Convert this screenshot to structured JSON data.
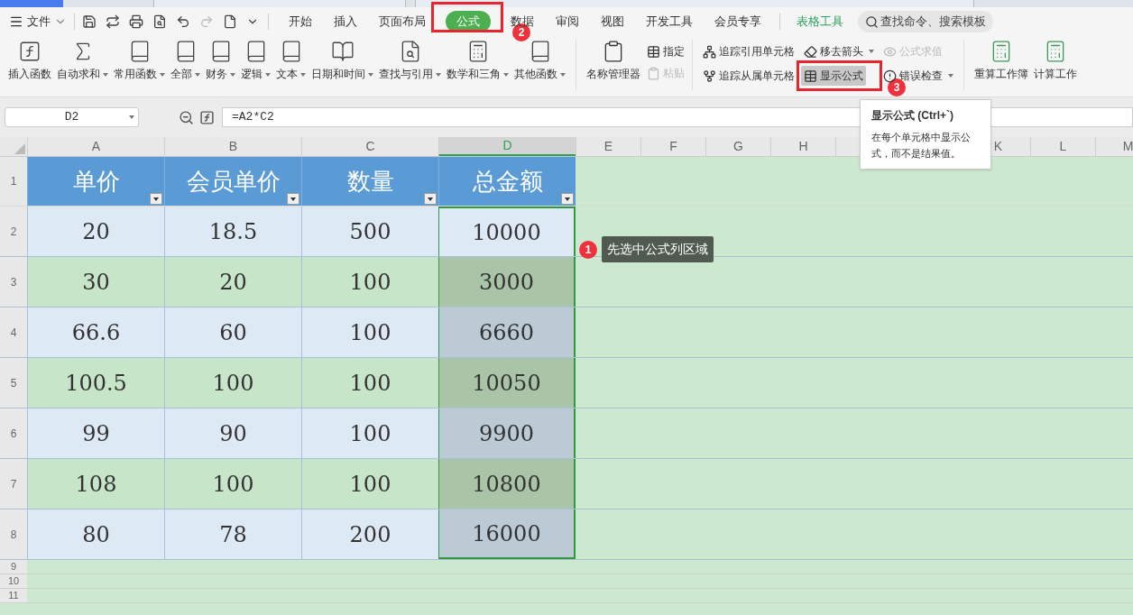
{
  "menu_bar": {
    "file_menu": "文件",
    "tabs": [
      {
        "label": "开始",
        "selected": false
      },
      {
        "label": "插入",
        "selected": false
      },
      {
        "label": "页面布局",
        "selected": false
      },
      {
        "label": "公式",
        "selected": true
      },
      {
        "label": "数据",
        "selected": false
      },
      {
        "label": "审阅",
        "selected": false
      },
      {
        "label": "视图",
        "selected": false
      },
      {
        "label": "开发工具",
        "selected": false
      },
      {
        "label": "会员专享",
        "selected": false
      }
    ],
    "context_tab": "表格工具",
    "search": {
      "placeholder": "查找命令、搜索模板"
    }
  },
  "ribbon": {
    "function_buttons": [
      {
        "label": "插入函数",
        "dropdown": false
      },
      {
        "label": "自动求和",
        "dropdown": true
      },
      {
        "label": "常用函数",
        "dropdown": true
      },
      {
        "label": "全部",
        "dropdown": true
      },
      {
        "label": "财务",
        "dropdown": true
      },
      {
        "label": "逻辑",
        "dropdown": true
      },
      {
        "label": "文本",
        "dropdown": true
      },
      {
        "label": "日期和时间",
        "dropdown": true
      },
      {
        "label": "查找与引用",
        "dropdown": true
      },
      {
        "label": "数学和三角",
        "dropdown": true
      },
      {
        "label": "其他函数",
        "dropdown": true
      }
    ],
    "name_manager": "名称管理器",
    "name_buttons": [
      {
        "label": "指定",
        "disabled": false
      },
      {
        "label": "粘贴",
        "disabled": true
      }
    ],
    "audit_buttons": [
      {
        "label": "追踪引用单元格",
        "dropdown": false,
        "disabled": false,
        "selected": false
      },
      {
        "label": "追踪从属单元格",
        "dropdown": false,
        "disabled": false,
        "selected": false
      },
      {
        "label": "移去箭头",
        "dropdown": true,
        "disabled": false,
        "selected": false
      },
      {
        "label": "显示公式",
        "dropdown": false,
        "disabled": false,
        "selected": true
      },
      {
        "label": "公式求值",
        "dropdown": false,
        "disabled": true,
        "selected": false
      },
      {
        "label": "错误检查",
        "dropdown": true,
        "disabled": false,
        "selected": false
      }
    ],
    "calc_buttons": [
      "重算工作簿",
      "计算工作"
    ]
  },
  "formula_bar": {
    "cell_ref": "D2",
    "formula": "=A2*C2"
  },
  "tooltip": {
    "title": "显示公式 (Ctrl+`)",
    "body": "在每个单元格中显示公式，而不是结果值。"
  },
  "sheet": {
    "columns": [
      {
        "label": "A",
        "selected": false
      },
      {
        "label": "B",
        "selected": false
      },
      {
        "label": "C",
        "selected": false
      },
      {
        "label": "D",
        "selected": true
      }
    ],
    "columns_right": [
      "E",
      "F",
      "G",
      "H"
    ],
    "columns_far": [
      "K",
      "L",
      "M"
    ],
    "table_headers": [
      "单价",
      "会员单价",
      "数量",
      "总金额"
    ],
    "rows": [
      {
        "number": "2",
        "active": true,
        "cells": [
          "20",
          "18.5",
          "500",
          "10000"
        ]
      },
      {
        "number": "3",
        "active": false,
        "cells": [
          "30",
          "20",
          "100",
          "3000"
        ]
      },
      {
        "number": "4",
        "active": false,
        "cells": [
          "66.6",
          "60",
          "100",
          "6660"
        ]
      },
      {
        "number": "5",
        "active": false,
        "cells": [
          "100.5",
          "100",
          "100",
          "10050"
        ]
      },
      {
        "number": "6",
        "active": false,
        "cells": [
          "99",
          "90",
          "100",
          "9900"
        ]
      },
      {
        "number": "7",
        "active": false,
        "cells": [
          "108",
          "100",
          "100",
          "10800"
        ]
      },
      {
        "number": "8",
        "active": false,
        "cells": [
          "80",
          "78",
          "200",
          "16000"
        ]
      }
    ],
    "header_row_number": "1",
    "empty_rows": [
      "9",
      "10",
      "11"
    ]
  },
  "annotations": [
    {
      "number": "1",
      "text": "先选中公式列区域"
    },
    {
      "number": "2"
    },
    {
      "number": "3"
    }
  ]
}
